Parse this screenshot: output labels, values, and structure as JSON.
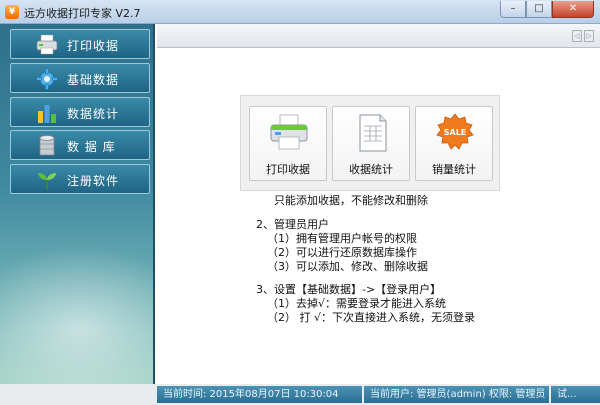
{
  "window": {
    "title": "远方收据打印专家 V2.7",
    "controls": {
      "minimize": "–",
      "maximize": "□",
      "close": "✕"
    }
  },
  "sidebar": {
    "items": [
      {
        "label": "打印收据",
        "icon": "printer-icon"
      },
      {
        "label": "基础数据",
        "icon": "gear-icon"
      },
      {
        "label": "数据统计",
        "icon": "bar-chart-icon"
      },
      {
        "label": "数 据 库",
        "icon": "database-icon"
      },
      {
        "label": "注册软件",
        "icon": "sprout-icon"
      }
    ]
  },
  "toolbar": {
    "scroll_left": "◁",
    "scroll_right": "▷"
  },
  "tiles": [
    {
      "label": "打印收据",
      "icon": "printer-icon"
    },
    {
      "label": "收据统计",
      "icon": "document-icon"
    },
    {
      "label": "销量统计",
      "icon": "sale-badge-icon",
      "badge_text": "SALE"
    }
  ],
  "notes": {
    "line_partial": "只能添加收据，不能修改和删除",
    "section2_title": "2、管理员用户",
    "section2_items": [
      "（1）拥有管理用户帐号的权限",
      "（2）可以进行还原数据库操作",
      "（3）可以添加、修改、删除收据"
    ],
    "section3_title": "3、设置【基础数据】->【登录用户】",
    "section3_items": [
      "（1）去掉√：需要登录才能进入系统",
      "（2） 打 √：下次直接进入系统，无须登录"
    ]
  },
  "status": {
    "time_label": "当前时间: 2015年08月07日 10:30:04",
    "user_label": "当前用户: 管理员(admin)  权限: 管理员",
    "extra": "试..."
  },
  "colors": {
    "sidebar_top": "#2f6f8a",
    "sidebar_bottom": "#a7d3c7",
    "nav_button": "#1f6485",
    "status_segment": "#2a6e92"
  }
}
